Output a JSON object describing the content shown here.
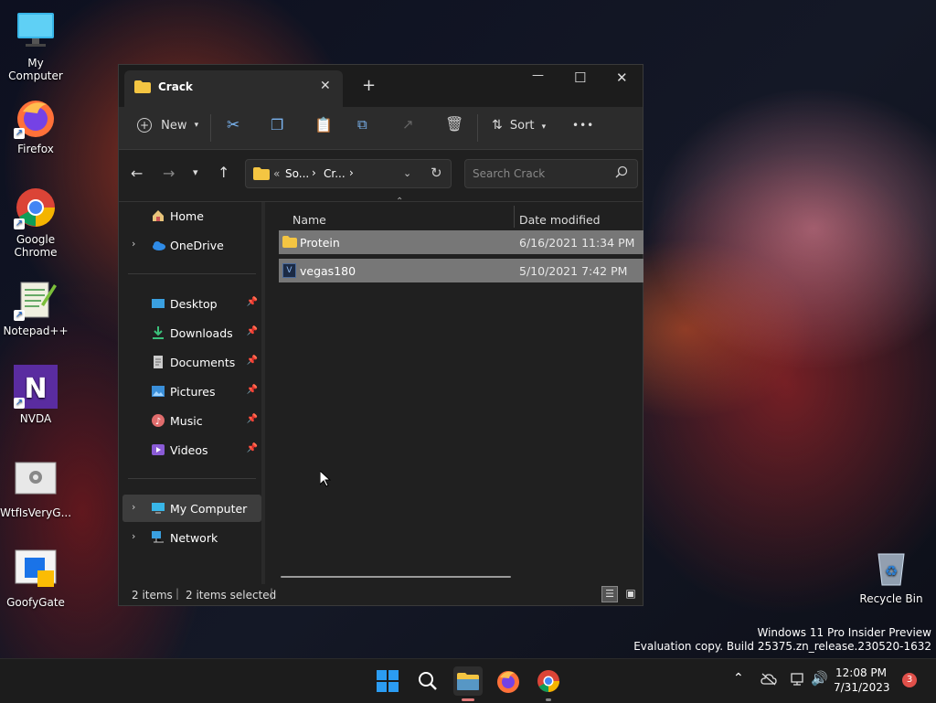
{
  "desktop": {
    "icons": [
      {
        "label": "My Computer"
      },
      {
        "label": "Firefox"
      },
      {
        "label": "Google Chrome"
      },
      {
        "label": "Notepad++"
      },
      {
        "label": "NVDA"
      },
      {
        "label": "WtfIsVeryG..."
      },
      {
        "label": "GoofyGate"
      },
      {
        "label": "Recycle Bin"
      }
    ],
    "watermark": {
      "line1": "Windows 11 Pro Insider Preview",
      "line2": "Evaluation copy. Build 25375.zn_release.230520-1632"
    }
  },
  "explorer": {
    "tab_title": "Crack",
    "new_tab": "+",
    "window_controls": {
      "minimize": "—",
      "maximize": "☐",
      "close": "✕"
    },
    "toolbar": {
      "new_label": "New",
      "sort_label": "Sort",
      "more": "•••"
    },
    "address": {
      "prefix": "«",
      "crumbs": [
        "So...",
        "Cr..."
      ],
      "sep": "›"
    },
    "search": {
      "placeholder": "Search Crack"
    },
    "nav": {
      "home": "Home",
      "onedrive": "OneDrive",
      "quick": [
        "Desktop",
        "Downloads",
        "Documents",
        "Pictures",
        "Music",
        "Videos"
      ],
      "my_computer": "My Computer",
      "network": "Network"
    },
    "columns": {
      "name": "Name",
      "date": "Date modified"
    },
    "files": [
      {
        "name": "Protein",
        "date": "6/16/2021 11:34 PM"
      },
      {
        "name": "vegas180",
        "date": "5/10/2021 7:42 PM"
      }
    ],
    "status": {
      "count": "2 items",
      "selected": "2 items selected"
    }
  },
  "taskbar": {
    "time": "12:08 PM",
    "date": "7/31/2023",
    "notification_count": "3"
  },
  "colors": {
    "accent": "#0078d4",
    "folder": "#f4c542",
    "selection": "#777777"
  }
}
